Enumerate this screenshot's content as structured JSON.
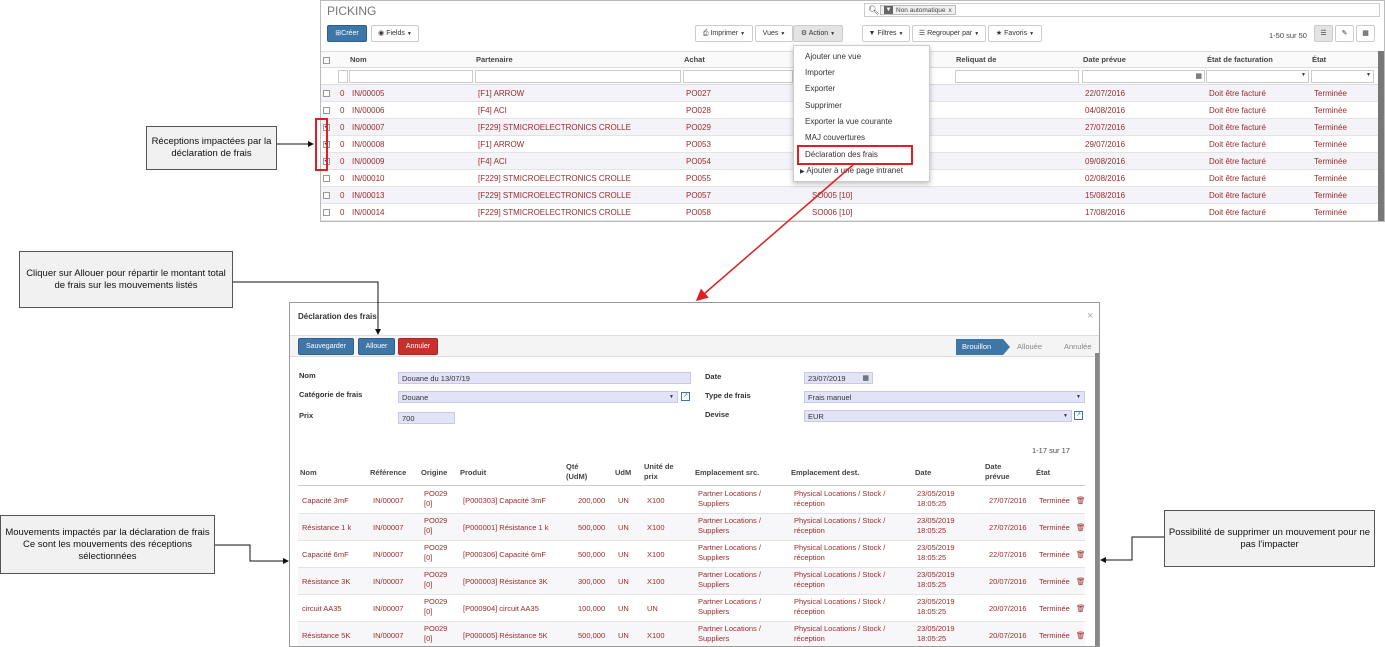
{
  "picking": {
    "title": "PICKING",
    "search_facet": "Non automatique",
    "search_facet_remove": "x",
    "buttons": {
      "create": "Créer",
      "fields": "Fields",
      "print": "Imprimer",
      "views": "Vues",
      "action": "Action",
      "filters": "Filtres",
      "groupby": "Regrouper par",
      "favorites": "Favoris"
    },
    "pager": "1-50 sur 50",
    "columns": [
      "Nom",
      "Partenaire",
      "Achat",
      "Reliquat de",
      "Date prévue",
      "État de facturation",
      "État"
    ],
    "rows": [
      {
        "zero": "0",
        "name": "IN/00005",
        "partner": "[F1] ARROW",
        "po": "PO027",
        "so": "",
        "date": "22/07/2016",
        "invoice": "Doit être facturé",
        "state": "Terminée",
        "checked": false
      },
      {
        "zero": "0",
        "name": "IN/00006",
        "partner": "[F4] ACI",
        "po": "PO028",
        "so": "",
        "date": "04/08/2016",
        "invoice": "Doit être facturé",
        "state": "Terminée",
        "checked": false
      },
      {
        "zero": "0",
        "name": "IN/00007",
        "partner": "[F229] STMICROELECTRONICS CROLLE",
        "po": "PO029",
        "so": "",
        "date": "27/07/2016",
        "invoice": "Doit être facturé",
        "state": "Terminée",
        "checked": true
      },
      {
        "zero": "0",
        "name": "IN/00008",
        "partner": "[F1] ARROW",
        "po": "PO053",
        "so": "",
        "date": "29/07/2016",
        "invoice": "Doit être facturé",
        "state": "Terminée",
        "checked": true
      },
      {
        "zero": "0",
        "name": "IN/00009",
        "partner": "[F4] ACI",
        "po": "PO054",
        "so": "",
        "date": "09/08/2016",
        "invoice": "Doit être facturé",
        "state": "Terminée",
        "checked": true
      },
      {
        "zero": "0",
        "name": "IN/00010",
        "partner": "[F229] STMICROELECTRONICS CROLLE",
        "po": "PO055",
        "so": "",
        "date": "02/08/2016",
        "invoice": "Doit être facturé",
        "state": "Terminée",
        "checked": false
      },
      {
        "zero": "0",
        "name": "IN/00013",
        "partner": "[F229] STMICROELECTRONICS CROLLE",
        "po": "PO057",
        "so": "SO005 [10]",
        "date": "15/08/2016",
        "invoice": "Doit être facturé",
        "state": "Terminée",
        "checked": false
      },
      {
        "zero": "0",
        "name": "IN/00014",
        "partner": "[F229] STMICROELECTRONICS CROLLE",
        "po": "PO058",
        "so": "SO006 [10]",
        "date": "17/08/2016",
        "invoice": "Doit être facturé",
        "state": "Terminée",
        "checked": false
      }
    ],
    "action_menu": [
      "Ajouter une vue",
      "Importer",
      "Exporter",
      "Supprimer",
      "Exporter la vue courante",
      "MAJ couvertures",
      "Déclaration des frais",
      "Ajouter à une page intranet"
    ]
  },
  "callouts": {
    "receptions": "Réceptions impactées par la déclaration de frais",
    "allouer": "Cliquer sur Allouer pour répartir le montant total de frais sur les mouvements listés",
    "mouvements": "Mouvements impactés par la déclaration de frais\nCe sont les mouvements des réceptions sélectionnées",
    "supprimer": "Possibilité de supprimer un mouvement pour ne pas l'impacter"
  },
  "dialog": {
    "title": "Déclaration des frais",
    "close": "×",
    "buttons": {
      "save": "Sauvegarder",
      "allocate": "Allouer",
      "cancel": "Annuler"
    },
    "stages": [
      "Brouillon",
      "Allouée",
      "Annulée"
    ],
    "form": {
      "name_label": "Nom",
      "name_value": "Douane du 13/07/19",
      "category_label": "Catégorie de frais",
      "category_value": "Douane",
      "price_label": "Prix",
      "price_value": "700",
      "date_label": "Date",
      "date_value": "23/07/2019",
      "type_label": "Type de frais",
      "type_value": "Frais manuel",
      "currency_label": "Devise",
      "currency_value": "EUR"
    },
    "pager": "1-17 sur 17",
    "columns": [
      "Nom",
      "Référence",
      "Origine",
      "Produit",
      "Qté (UdM)",
      "UdM",
      "Unité de prix",
      "Emplacement src.",
      "Emplacement dest.",
      "Date",
      "Date prévue",
      "État"
    ],
    "moves": [
      {
        "name": "Capacité 3mF",
        "ref": "IN/00007",
        "origin": "PO029 [0]",
        "product": "[P000303] Capacité 3mF",
        "qty": "200,000",
        "uom": "UN",
        "price_unit": "X100",
        "src": "Partner Locations / Suppliers",
        "dest": "Physical Locations / Stock / réception",
        "date": "23/05/2019 18:05:25",
        "planned": "27/07/2016",
        "state": "Terminée"
      },
      {
        "name": "Résistance 1 k",
        "ref": "IN/00007",
        "origin": "PO029 [0]",
        "product": "[P000001] Résistance 1 k",
        "qty": "500,000",
        "uom": "UN",
        "price_unit": "X100",
        "src": "Partner Locations / Suppliers",
        "dest": "Physical Locations / Stock / réception",
        "date": "23/05/2019 18:05:25",
        "planned": "27/07/2016",
        "state": "Terminée"
      },
      {
        "name": "Capacité 6mF",
        "ref": "IN/00007",
        "origin": "PO029 [0]",
        "product": "[P000306] Capacité 6mF",
        "qty": "500,000",
        "uom": "UN",
        "price_unit": "X100",
        "src": "Partner Locations / Suppliers",
        "dest": "Physical Locations / Stock / réception",
        "date": "23/05/2019 18:05:25",
        "planned": "22/07/2016",
        "state": "Terminée"
      },
      {
        "name": "Résistance 3K",
        "ref": "IN/00007",
        "origin": "PO029 [0]",
        "product": "[P000003] Résistance 3K",
        "qty": "300,000",
        "uom": "UN",
        "price_unit": "X100",
        "src": "Partner Locations / Suppliers",
        "dest": "Physical Locations / Stock / réception",
        "date": "23/05/2019 18:05:25",
        "planned": "20/07/2016",
        "state": "Terminée"
      },
      {
        "name": "circuit AA35",
        "ref": "IN/00007",
        "origin": "PO029 [0]",
        "product": "[P000904] circuit AA35",
        "qty": "100,000",
        "uom": "UN",
        "price_unit": "UN",
        "src": "Partner Locations / Suppliers",
        "dest": "Physical Locations / Stock / réception",
        "date": "23/05/2019 18:05:25",
        "planned": "20/07/2016",
        "state": "Terminée"
      },
      {
        "name": "Résistance 5K",
        "ref": "IN/00007",
        "origin": "PO029 [0]",
        "product": "[P000005] Résistance 5K",
        "qty": "500,000",
        "uom": "UN",
        "price_unit": "X100",
        "src": "Partner Locations / Suppliers",
        "dest": "Physical Locations / Stock / réception",
        "date": "23/05/2019 18:05:25",
        "planned": "20/07/2016",
        "state": "Terminée"
      }
    ]
  },
  "colors": {
    "primary": "#3e76a8",
    "danger": "#c9302c",
    "link_red": "#9a2a2a",
    "highlight": "#e02020"
  }
}
